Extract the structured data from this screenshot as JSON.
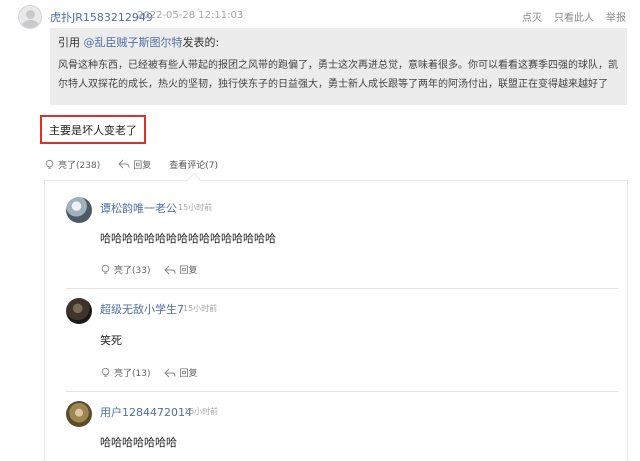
{
  "post": {
    "author": "虎扑JR1583212949",
    "time": "2022-05-28 12:11:03",
    "actions": [
      "点灭",
      "只看此人",
      "举报"
    ],
    "quote": {
      "prefix": "引用 ",
      "user": "@乱臣贼子斯图尔特",
      "suffix": "发表的:",
      "lines": [
        "风骨这种东西，已经被有些人带起的报团之风带的跑偏了，勇士这次再进总觉，意味着很多。你可以看看这赛季四强的球队，凯",
        "尔特人双探花的成长，热火的坚韧，独行侠东子的日益强大，勇士新人成长跟等了两年的阿汤付出，联盟正在变得越来越好了"
      ]
    },
    "reply": "主要是坏人变老了",
    "light_label": "亮了(238)",
    "reply_label": "回复",
    "view_comments_label": "查看评论(7)"
  },
  "comments": [
    {
      "name": "谭松韵唯一老公",
      "time": "15小时前",
      "text": "哈哈哈哈哈哈哈哈哈哈哈哈哈哈哈哈",
      "light": "亮了(33)",
      "reply": "回复"
    },
    {
      "name": "超级无敌小学生7",
      "time": "15小时前",
      "text": "笑死",
      "light": "亮了(13)",
      "reply": "回复"
    },
    {
      "name": "用户1284472014",
      "time": "15小时前",
      "text": "哈哈哈哈哈哈哈",
      "light": "",
      "reply": ""
    }
  ],
  "colors": {
    "link": "#4f6fa8",
    "highlight_border": "#d6332e",
    "quote_bg": "#ececec"
  },
  "icons": {
    "light": "lightbulb-icon",
    "reply": "reply-arrow-icon"
  }
}
